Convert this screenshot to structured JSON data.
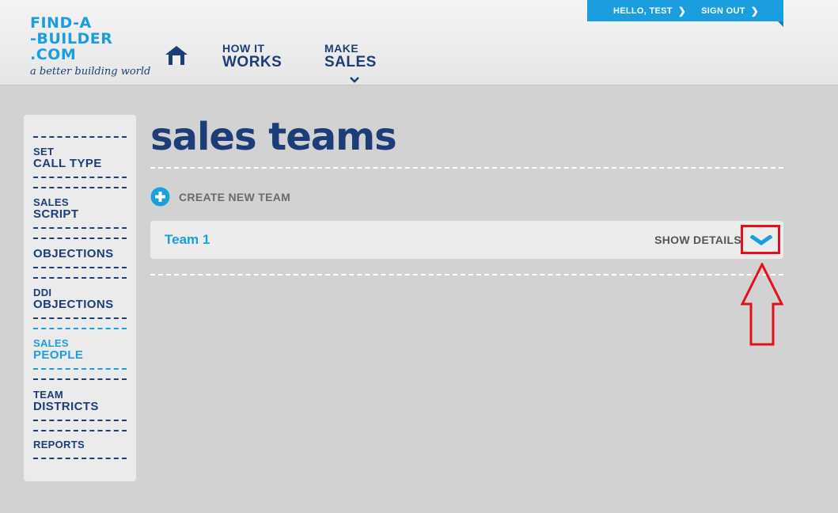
{
  "header": {
    "logo_lines": [
      "FIND-A",
      "-BUILDER",
      ".COM"
    ],
    "logo_tagline": "a better building world",
    "nav": [
      {
        "top": "HOW IT",
        "bottom": "WORKS"
      },
      {
        "top": "MAKE",
        "bottom": "SALES"
      }
    ],
    "user": {
      "greeting": "HELLO, TEST",
      "signout": "SIGN OUT"
    }
  },
  "sidebar": {
    "items": [
      {
        "top": "SET",
        "bottom": "CALL TYPE",
        "active": false
      },
      {
        "top": "SALES",
        "bottom": "SCRIPT",
        "active": false
      },
      {
        "top": "",
        "bottom": "OBJECTIONS",
        "active": false
      },
      {
        "top": "DDI",
        "bottom": "OBJECTIONS",
        "active": false
      },
      {
        "top": "SALES",
        "bottom": "PEOPLE",
        "active": true
      },
      {
        "top": "TEAM",
        "bottom": "DISTRICTS",
        "active": false
      },
      {
        "top": "",
        "bottom": "REPORTS",
        "active": false
      }
    ]
  },
  "main": {
    "title": "sales teams",
    "create_label": "CREATE NEW TEAM",
    "teams": [
      {
        "name": "Team 1",
        "action": "SHOW DETAILS"
      }
    ]
  },
  "colors": {
    "brand_blue": "#1a9ee0",
    "navy": "#1c3d78",
    "highlight_red": "#e3101c"
  }
}
